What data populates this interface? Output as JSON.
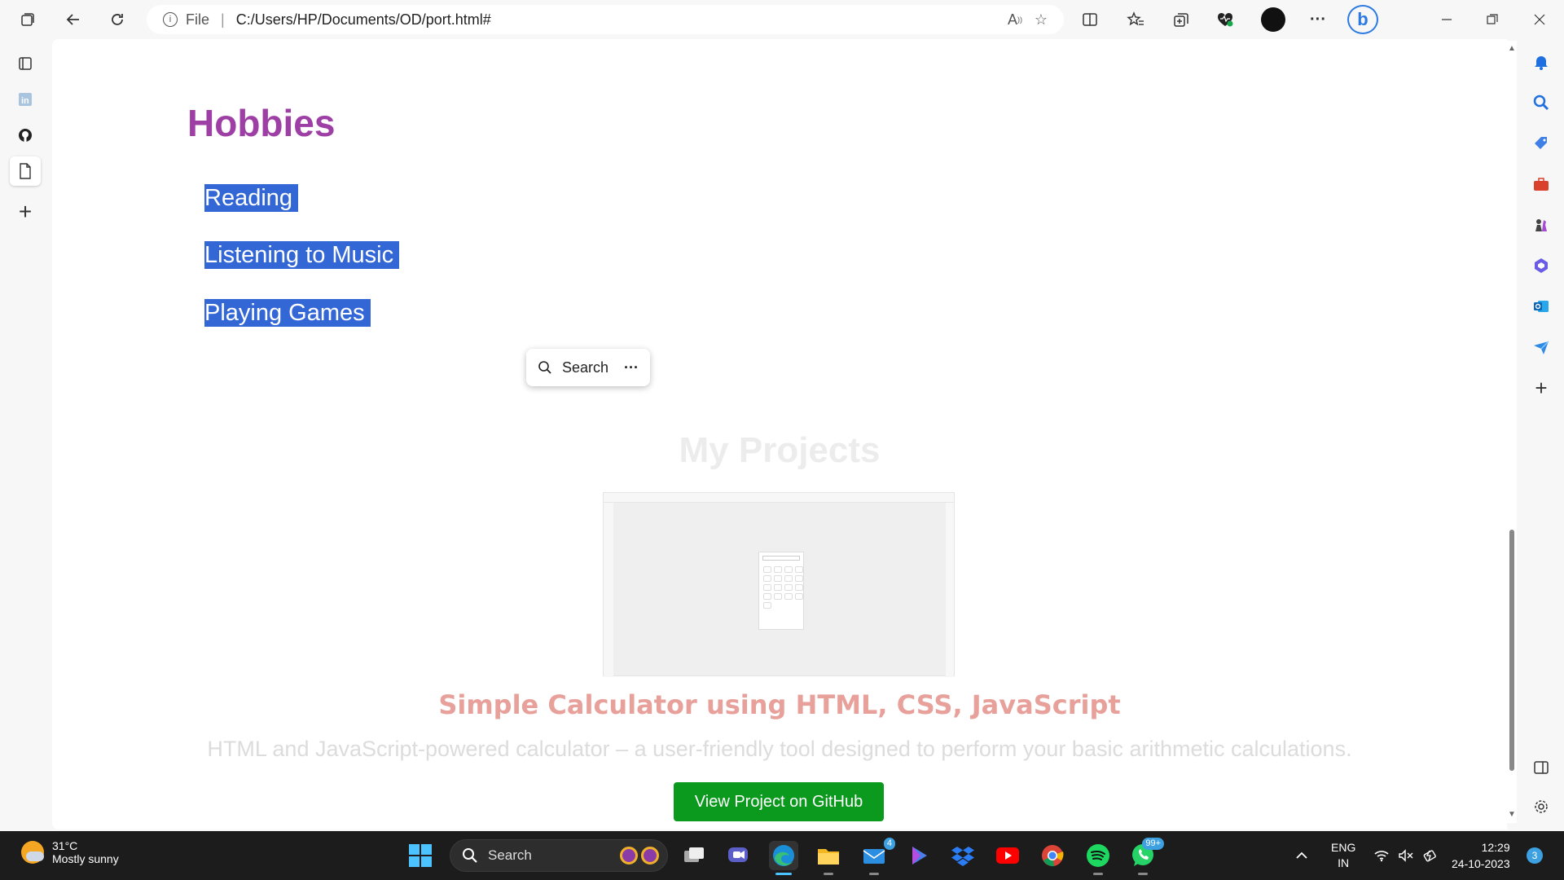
{
  "browser": {
    "address_prefix": "File",
    "address_sep": "|",
    "url": "C:/Users/HP/Documents/OD/port.html#"
  },
  "page": {
    "hobbies_title": "Hobbies",
    "hobbies": [
      "Reading",
      "Listening to Music",
      "Playing Games"
    ],
    "search_popup": {
      "label": "Search",
      "more": "···"
    },
    "projects_title": "My Projects",
    "project": {
      "name": "Simple Calculator using HTML, CSS, JavaScript",
      "description": "HTML and JavaScript-powered calculator – a user-friendly tool designed to perform your basic arithmetic calculations.",
      "button_label": "View Project on GitHub"
    }
  },
  "taskbar": {
    "weather_temp": "31°C",
    "weather_desc": "Mostly sunny",
    "search_label": "Search",
    "mail_badge": "4",
    "whatsapp_badge": "99+",
    "lang_line1": "ENG",
    "lang_line2": "IN",
    "time": "12:29",
    "date": "24-10-2023",
    "notification_count": "3"
  },
  "colors": {
    "hobbies_title": "#9e3fa6",
    "selection": "#3467d6",
    "project_name": "#e8a09a",
    "github_button": "#0c9a1e"
  }
}
